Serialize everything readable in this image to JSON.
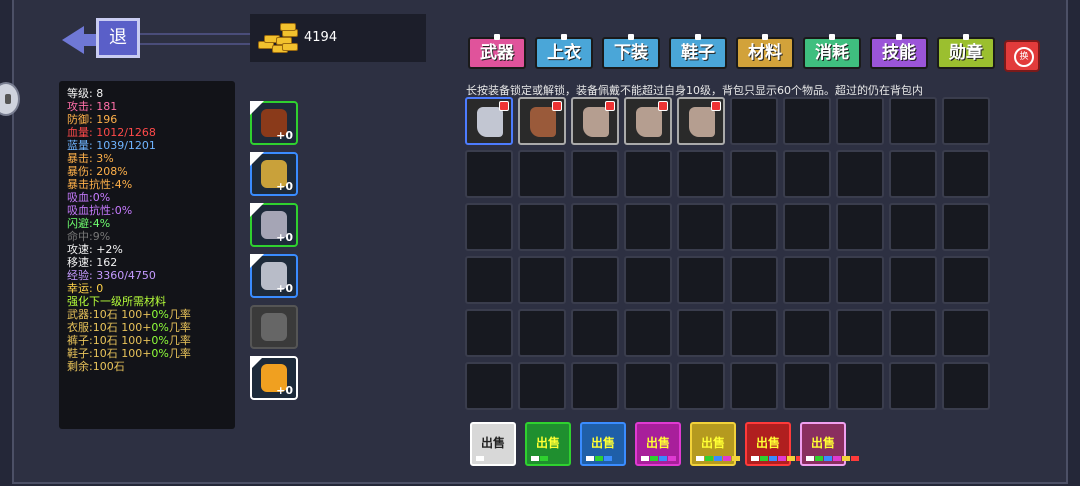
{
  "header": {
    "back_label": "退",
    "gold_amount": "4194"
  },
  "stats": [
    {
      "text": "等级: 8",
      "color": "white"
    },
    {
      "text": "攻击: 181",
      "color": "pink"
    },
    {
      "text": "防御: 196",
      "color": "orange"
    },
    {
      "text": "血量: 1012/1268",
      "color": "red"
    },
    {
      "text": "蓝量: 1039/1201",
      "color": "blue"
    },
    {
      "text": "暴击: 3%",
      "color": "orange"
    },
    {
      "text": "暴伤: 208%",
      "color": "orange"
    },
    {
      "text": "暴击抗性:4%",
      "color": "orange"
    },
    {
      "text": "吸血:0%",
      "color": "purple"
    },
    {
      "text": "吸血抗性:0%",
      "color": "purple"
    },
    {
      "text": "闪避:4%",
      "color": "green"
    },
    {
      "text": "命中:9%",
      "color": "gray"
    },
    {
      "text": "攻速: +2%",
      "color": "white"
    },
    {
      "text": "移速: 162",
      "color": "white"
    },
    {
      "text": "经验: 3360/4750",
      "color": "lilac"
    },
    {
      "text": "幸运: 0",
      "color": "yellow"
    },
    {
      "text": "强化下一级所需材料",
      "color": "lime"
    }
  ],
  "upgrade_costs": [
    {
      "label": "武器:10石 100+",
      "pct": "0%",
      "tail": "几率"
    },
    {
      "label": "衣服:10石 100+",
      "pct": "0%",
      "tail": "几率"
    },
    {
      "label": "裤子:10石 100+",
      "pct": "0%",
      "tail": "几率"
    },
    {
      "label": "鞋子:10石 100+",
      "pct": "0%",
      "tail": "几率"
    }
  ],
  "remaining": "剩余:100石",
  "equipped": [
    {
      "slot": "weapon",
      "plus": "+0",
      "border": "#2fd12f",
      "item_color": "#8a3a1a"
    },
    {
      "slot": "armor",
      "plus": "+0",
      "border": "#3a8cff",
      "item_color": "#c9a13a"
    },
    {
      "slot": "pants",
      "plus": "+0",
      "border": "#2fd12f",
      "item_color": "#a5a5b5"
    },
    {
      "slot": "shoes",
      "plus": "+0",
      "border": "#3a8cff",
      "item_color": "#b8bcc8"
    },
    {
      "slot": "pet",
      "plus": "",
      "border": "#555",
      "item_color": "#666"
    },
    {
      "slot": "skill",
      "plus": "+0",
      "border": "#ffffff",
      "item_color": "#f0a020"
    }
  ],
  "tabs": [
    {
      "label": "武器",
      "color": "#e0539b"
    },
    {
      "label": "上衣",
      "color": "#4aa6d8"
    },
    {
      "label": "下装",
      "color": "#4aa6d8"
    },
    {
      "label": "鞋子",
      "color": "#4aa6d8"
    },
    {
      "label": "材料",
      "color": "#d2a23a"
    },
    {
      "label": "消耗",
      "color": "#3fbf7f"
    },
    {
      "label": "技能",
      "color": "#9b55d8"
    },
    {
      "label": "勋章",
      "color": "#9bbf2f"
    }
  ],
  "hint_text": "长按装备锁定或解锁，装备佩戴不能超过自身10级，背包只显示60个物品。超过的仍在背包内",
  "inventory": [
    {
      "color": "#c2c6d2",
      "locked": true,
      "selected": true
    },
    {
      "color": "#9a5a3a",
      "locked": true,
      "selected": false
    },
    {
      "color": "#b59e90",
      "locked": true,
      "selected": false
    },
    {
      "color": "#b59e90",
      "locked": true,
      "selected": false
    },
    {
      "color": "#b59e90",
      "locked": true,
      "selected": false
    }
  ],
  "sell_buttons": [
    {
      "label": "出售",
      "bg": "#d8d8d8",
      "border": "#ffffff",
      "text": "#222",
      "dots": [
        "#ffffff"
      ]
    },
    {
      "label": "出售",
      "bg": "#1f8f2f",
      "border": "#2fd12f",
      "text": "#ff3",
      "dots": [
        "#ffffff",
        "#2fd12f"
      ]
    },
    {
      "label": "出售",
      "bg": "#1f5fa8",
      "border": "#3a8cff",
      "text": "#ff3",
      "dots": [
        "#ffffff",
        "#2fd12f",
        "#3a8cff"
      ]
    },
    {
      "label": "出售",
      "bg": "#a81f9b",
      "border": "#e03ad2",
      "text": "#ff3",
      "dots": [
        "#ffffff",
        "#2fd12f",
        "#3a8cff",
        "#e03ad2"
      ]
    },
    {
      "label": "出售",
      "bg": "#b59a1f",
      "border": "#f2d23a",
      "text": "#ff3",
      "dots": [
        "#ffffff",
        "#2fd12f",
        "#3a8cff",
        "#e03ad2",
        "#f2d23a"
      ]
    },
    {
      "label": "出售",
      "bg": "#b01f1f",
      "border": "#ff3a3a",
      "text": "#ff3",
      "dots": [
        "#ffffff",
        "#2fd12f",
        "#3a8cff",
        "#e03ad2",
        "#f2d23a",
        "#ff3a3a"
      ]
    },
    {
      "label": "出售",
      "bg": "#8a2f5f",
      "border": "#f0a0f0",
      "text": "#ff3",
      "dots": [
        "#ffffff",
        "#2fd12f",
        "#3a8cff",
        "#e03ad2",
        "#f2d23a",
        "#ff3a3a"
      ]
    }
  ]
}
